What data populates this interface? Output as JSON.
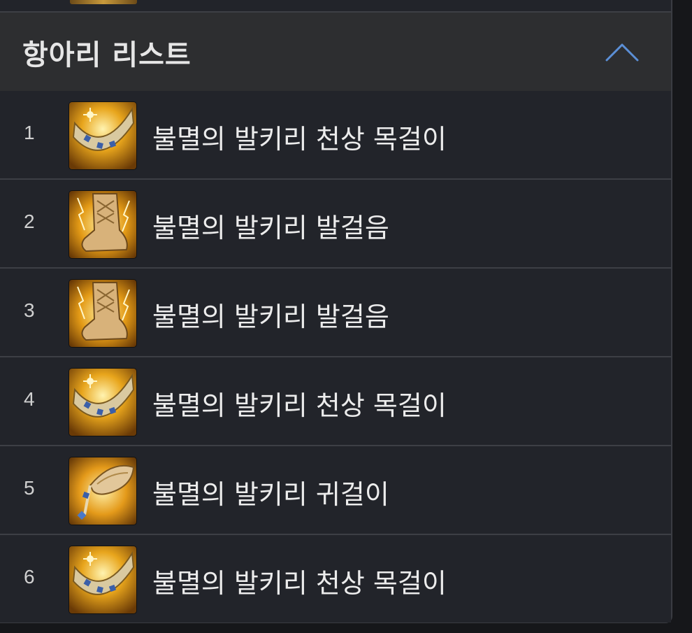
{
  "header": {
    "title": "항아리 리스트"
  },
  "items": [
    {
      "rank": "1",
      "name": "불멸의 발키리 천상 목걸이",
      "icon": "necklace-icon"
    },
    {
      "rank": "2",
      "name": "불멸의 발키리 발걸음",
      "icon": "boots-icon"
    },
    {
      "rank": "3",
      "name": "불멸의 발키리 발걸음",
      "icon": "boots-icon"
    },
    {
      "rank": "4",
      "name": "불멸의 발키리 천상 목걸이",
      "icon": "necklace-icon"
    },
    {
      "rank": "5",
      "name": "불멸의 발키리 귀걸이",
      "icon": "earring-icon"
    },
    {
      "rank": "6",
      "name": "불멸의 발키리 천상 목걸이",
      "icon": "necklace-icon"
    }
  ],
  "colors": {
    "accent": "#5b8fd6",
    "panel": "#22242a",
    "header": "#2d2e30",
    "divider": "#3d3f45"
  }
}
